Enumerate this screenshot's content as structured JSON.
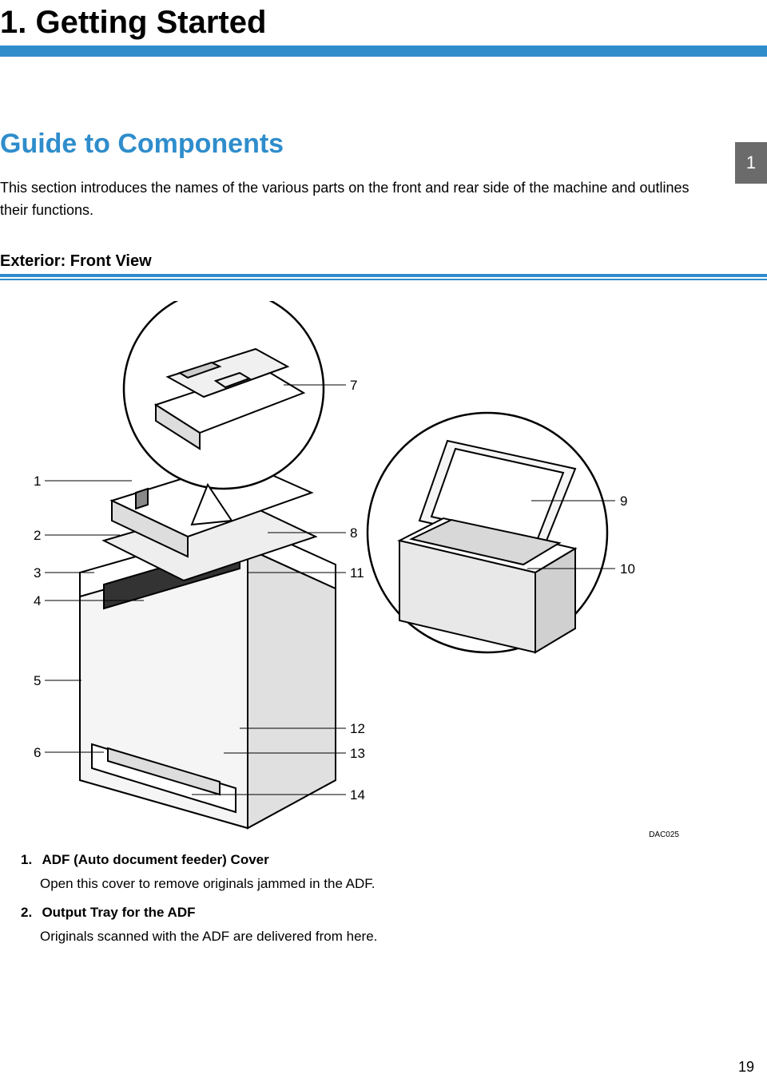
{
  "chapter": {
    "title": "1. Getting Started"
  },
  "section": {
    "title": "Guide to Components",
    "intro": "This section introduces the names of the various parts on the front and rear side of the machine and outlines their functions."
  },
  "subsection": {
    "title": "Exterior: Front View"
  },
  "tab": {
    "number": "1"
  },
  "diagram": {
    "code": "DAC025",
    "callouts": {
      "c1": "1",
      "c2": "2",
      "c3": "3",
      "c4": "4",
      "c5": "5",
      "c6": "6",
      "c7": "7",
      "c8": "8",
      "c9": "9",
      "c10": "10",
      "c11": "11",
      "c12": "12",
      "c13": "13",
      "c14": "14"
    }
  },
  "items": [
    {
      "num": "1.",
      "title": "ADF (Auto document feeder) Cover",
      "desc": "Open this cover to remove originals jammed in the ADF."
    },
    {
      "num": "2.",
      "title": "Output Tray for the ADF",
      "desc": "Originals scanned with the ADF are delivered from here."
    }
  ],
  "page_number": "19"
}
